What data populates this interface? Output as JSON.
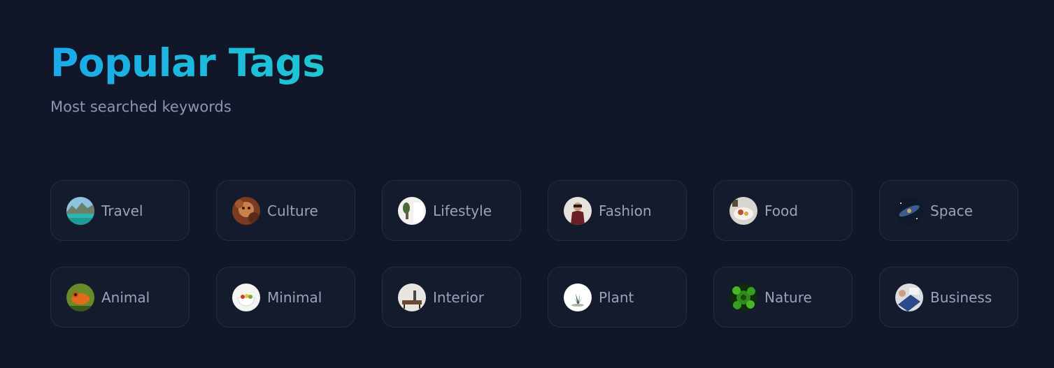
{
  "header": {
    "title": "Popular Tags",
    "subtitle": "Most searched keywords"
  },
  "colors": {
    "background": "#111729",
    "title_gradient_start": "#1aa9ea",
    "title_gradient_end": "#1fc7d2",
    "card_background": "#131b2d",
    "card_border": "#242d40",
    "label_text": "#9aa3b9"
  },
  "tags": [
    {
      "label": "Travel",
      "thumb": "travel-lake-thumbnail"
    },
    {
      "label": "Culture",
      "thumb": "culture-portrait-thumbnail"
    },
    {
      "label": "Lifestyle",
      "thumb": "lifestyle-plant-thumbnail"
    },
    {
      "label": "Fashion",
      "thumb": "fashion-person-thumbnail"
    },
    {
      "label": "Food",
      "thumb": "food-plate-thumbnail"
    },
    {
      "label": "Space",
      "thumb": "space-galaxy-thumbnail"
    },
    {
      "label": "Animal",
      "thumb": "animal-frog-thumbnail"
    },
    {
      "label": "Minimal",
      "thumb": "minimal-bowl-thumbnail"
    },
    {
      "label": "Interior",
      "thumb": "interior-room-thumbnail"
    },
    {
      "label": "Plant",
      "thumb": "plant-succulent-thumbnail"
    },
    {
      "label": "Nature",
      "thumb": "nature-leaves-thumbnail"
    },
    {
      "label": "Business",
      "thumb": "business-desk-thumbnail"
    }
  ]
}
